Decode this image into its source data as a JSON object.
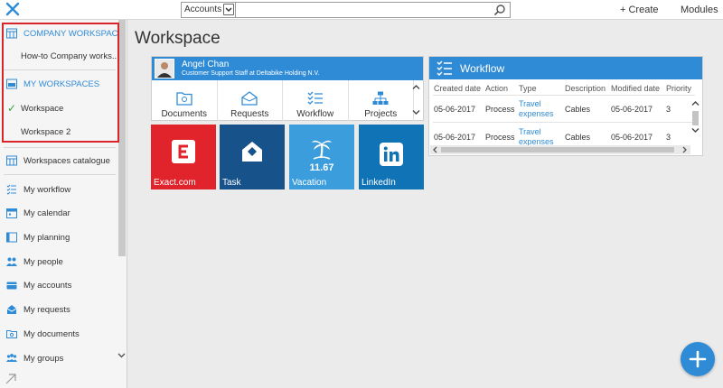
{
  "topbar": {
    "search_scope": "Accounts",
    "search_placeholder": "",
    "create_label": "+ Create",
    "modules_label": "Modules"
  },
  "sidebar": {
    "company_header": "COMPANY WORKSPACES",
    "company_item": "How-to Company works...",
    "my_header": "MY WORKSPACES",
    "workspace_active": "Workspace",
    "workspace_2": "Workspace 2",
    "catalogue": "Workspaces catalogue",
    "nav": [
      "My workflow",
      "My calendar",
      "My planning",
      "My people",
      "My accounts",
      "My requests",
      "My documents",
      "My groups"
    ]
  },
  "page": {
    "title": "Workspace"
  },
  "profile": {
    "name": "Angel Chan",
    "role": "Customer Support Staff at Deltabike Holding N.V.",
    "shortcuts": [
      "Documents",
      "Requests",
      "Workflow",
      "Projects"
    ]
  },
  "tiles": {
    "exact": "Exact.com",
    "task": "Task",
    "vacation": "Vacation",
    "vacation_value": "11.67",
    "linkedin": "LinkedIn"
  },
  "workflow": {
    "title": "Workflow",
    "columns": [
      "Created date",
      "Action",
      "Type",
      "Description",
      "Modified date",
      "Priority"
    ],
    "rows": [
      {
        "created": "05-06-2017",
        "action": "Process",
        "type_line1": "Travel",
        "type_line2": "expenses",
        "description": "Cables",
        "modified": "05-06-2017",
        "priority": "3"
      },
      {
        "created": "05-06-2017",
        "action": "Process",
        "type_line1": "Travel",
        "type_line2": "expenses",
        "description": "Cables",
        "modified": "05-06-2017",
        "priority": "3"
      }
    ]
  },
  "colors": {
    "accent": "#2f8bd6",
    "exact_red": "#e1232b",
    "task_navy": "#17528a",
    "vacation_blue": "#3b9ddc",
    "linkedin_blue": "#0f73b5",
    "highlight_red": "#d9242a"
  },
  "icons": [
    "close-x-icon",
    "search-icon",
    "grid-icon",
    "check-icon",
    "workflow-icon",
    "calendar-icon",
    "planning-icon",
    "people-icon",
    "accounts-icon",
    "requests-icon",
    "documents-icon",
    "groups-icon",
    "plus-icon",
    "expand-icon"
  ]
}
